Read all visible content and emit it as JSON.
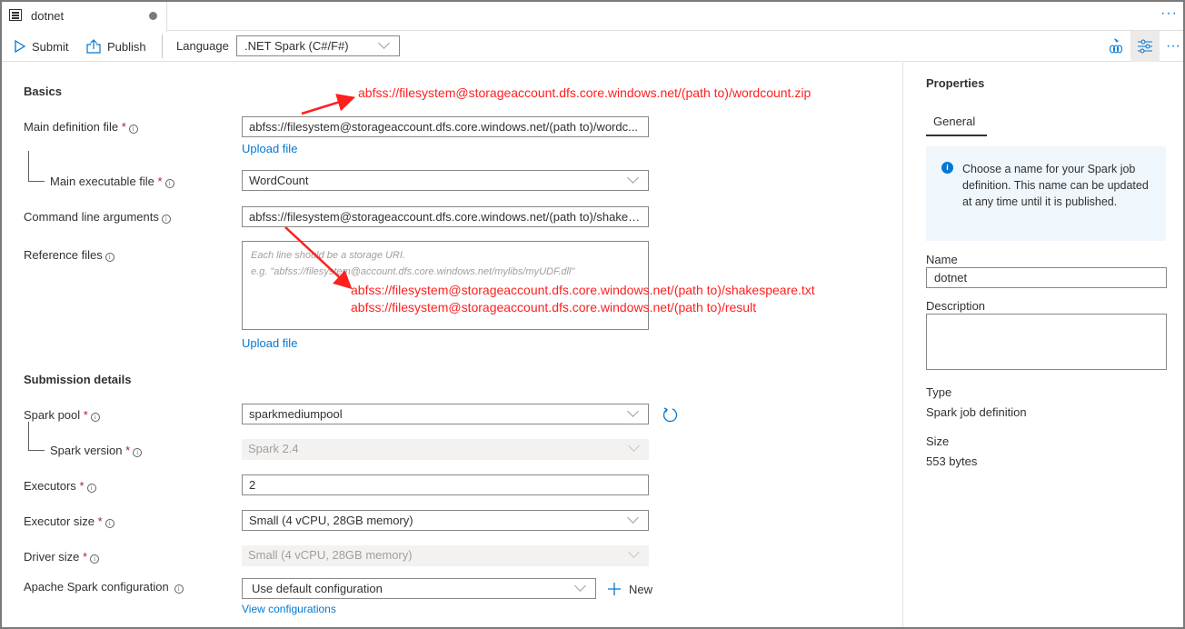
{
  "tab": {
    "title": "dotnet",
    "icon": "document-list-icon",
    "unsaved_indicator": true
  },
  "toolbar": {
    "submit_label": "Submit",
    "publish_label": "Publish",
    "language_label": "Language",
    "language_value": ".NET Spark (C#/F#)"
  },
  "form": {
    "basics_title": "Basics",
    "main_definition_file": {
      "label": "Main definition file",
      "required": "*",
      "value": "abfss://filesystem@storageaccount.dfs.core.windows.net/(path to)/wordc..."
    },
    "upload_file_1": "Upload file",
    "main_executable_file": {
      "label": "Main executable file",
      "required": "*",
      "value": "WordCount"
    },
    "command_line_arguments": {
      "label": "Command line arguments",
      "value": "abfss://filesystem@storageaccount.dfs.core.windows.net/(path to)/shakes..."
    },
    "reference_files": {
      "label": "Reference files",
      "placeholder_line1": "Each line should be a storage URI.",
      "placeholder_line2": "e.g. \"abfss://filesystem@account.dfs.core.windows.net/mylibs/myUDF.dll\""
    },
    "upload_file_2": "Upload file",
    "submission_title": "Submission details",
    "spark_pool": {
      "label": "Spark pool",
      "required": "*",
      "value": "sparkmediumpool"
    },
    "spark_version": {
      "label": "Spark version",
      "required": "*",
      "value": "Spark 2.4"
    },
    "executors": {
      "label": "Executors",
      "required": "*",
      "value": "2"
    },
    "executor_size": {
      "label": "Executor size",
      "required": "*",
      "value": "Small (4 vCPU, 28GB memory)"
    },
    "driver_size": {
      "label": "Driver size",
      "required": "*",
      "value": "Small (4 vCPU, 28GB memory)"
    },
    "spark_configuration": {
      "label": "Apache Spark configuration",
      "value": "Use default configuration"
    },
    "new_label": "New",
    "view_configurations": "View configurations"
  },
  "annotations": {
    "main_file": "abfss://filesystem@storageaccount.dfs.core.windows.net/(path to)/wordcount.zip",
    "arg_1": "abfss://filesystem@storageaccount.dfs.core.windows.net/(path to)/shakespeare.txt",
    "arg_2": "abfss://filesystem@storageaccount.dfs.core.windows.net/(path to)/result",
    "color": "#ff1f1f"
  },
  "properties": {
    "title": "Properties",
    "tab_general": "General",
    "info_text": "Choose a name for your Spark job definition. This name can be updated at any time until it is published.",
    "name_label": "Name",
    "name_value": "dotnet",
    "description_label": "Description",
    "description_value": "",
    "type_label": "Type",
    "type_value": "Spark job definition",
    "size_label": "Size",
    "size_value": "553 bytes"
  },
  "colors": {
    "accent": "#0078d4",
    "required": "#a4262c",
    "info_bg": "#eff6fc"
  }
}
